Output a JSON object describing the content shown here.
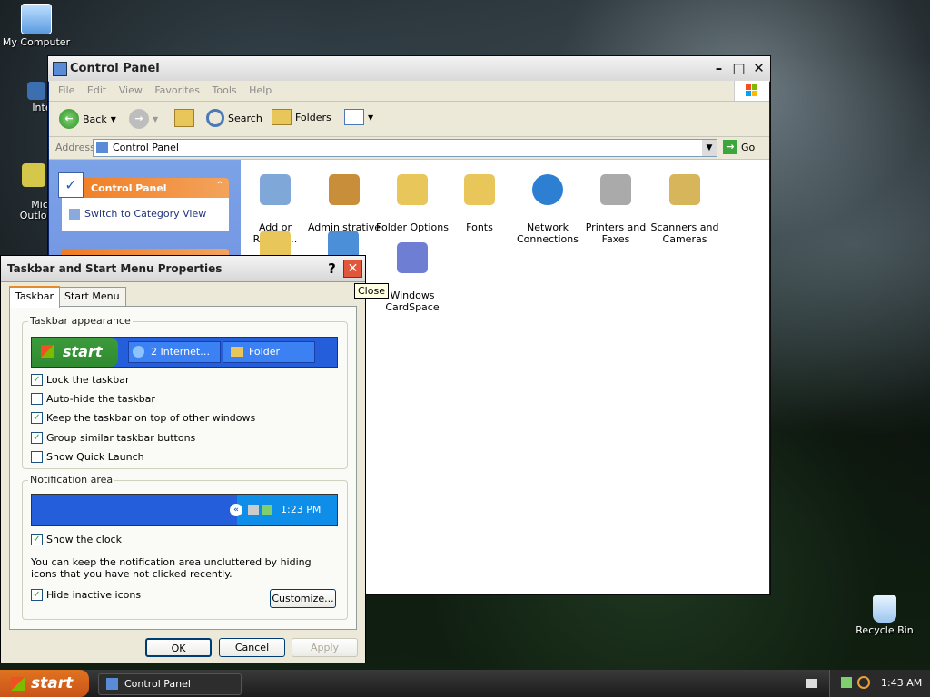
{
  "desktop": {
    "icons": [
      {
        "label": "My Computer"
      },
      {
        "label": "Interne"
      },
      {
        "label": "Microsc\nOutloo"
      },
      {
        "label": "Recycle Bin"
      }
    ]
  },
  "control_panel": {
    "title": "Control Panel",
    "menu": [
      "File",
      "Edit",
      "View",
      "Favorites",
      "Tools",
      "Help"
    ],
    "toolbar": {
      "back": "Back",
      "search": "Search",
      "folders": "Folders"
    },
    "address": {
      "label": "Address",
      "value": "Control Panel",
      "go": "Go"
    },
    "sidepanel": {
      "title": "Control Panel",
      "link": "Switch to Category View"
    },
    "items": [
      {
        "label": "Add or\nRemov…",
        "color": "#7fa8d8"
      },
      {
        "label": "Administrative\nTools",
        "color": "#c98e3a"
      },
      {
        "label": "Folder Options",
        "color": "#e8c65a"
      },
      {
        "label": "Fonts",
        "color": "#e8c65a"
      },
      {
        "label": "Network\nConnections",
        "color": "#2d7fd1"
      },
      {
        "label": "Printers and\nFaxes",
        "color": "#aaaaaa"
      },
      {
        "label": "Scanners and\nCameras",
        "color": "#d7b55a"
      },
      {
        "label": "Windows\nCardSpace",
        "color": "#6e7fd3"
      }
    ]
  },
  "dialog": {
    "title": "Taskbar and Start Menu Properties",
    "help": "?",
    "close_tooltip": "Close",
    "tabs": [
      "Taskbar",
      "Start Menu"
    ],
    "appearance": {
      "legend": "Taskbar appearance",
      "preview_start": "start",
      "preview_item1": "2 Internet…",
      "preview_item2": "Folder",
      "options": [
        {
          "label": "Lock the taskbar",
          "checked": true
        },
        {
          "label": "Auto-hide the taskbar",
          "checked": false
        },
        {
          "label": "Keep the taskbar on top of other windows",
          "checked": true
        },
        {
          "label": "Group similar taskbar buttons",
          "checked": true
        },
        {
          "label": "Show Quick Launch",
          "checked": false
        }
      ]
    },
    "notification": {
      "legend": "Notification area",
      "preview_time": "1:23 PM",
      "show_clock": "Show the clock",
      "description": "You can keep the notification area uncluttered by hiding icons that you have not clicked recently.",
      "hide_inactive": "Hide inactive icons",
      "customize": "Customize..."
    },
    "buttons": {
      "ok": "OK",
      "cancel": "Cancel",
      "apply": "Apply"
    }
  },
  "taskbar": {
    "start": "start",
    "task": "Control Panel",
    "clock": "1:43 AM"
  }
}
